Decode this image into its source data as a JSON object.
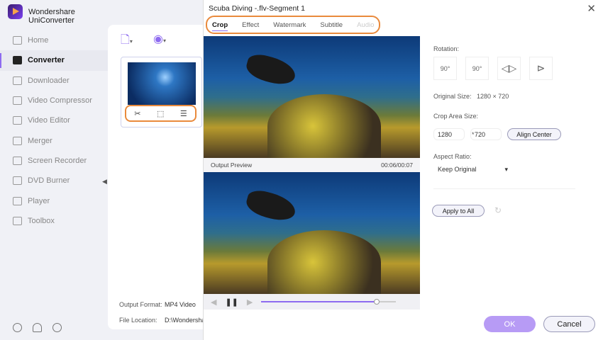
{
  "app": {
    "title": "Wondershare UniConverter"
  },
  "sidebar": {
    "items": [
      {
        "label": "Home",
        "icon": "home-icon"
      },
      {
        "label": "Converter",
        "icon": "converter-icon",
        "active": true
      },
      {
        "label": "Downloader",
        "icon": "download-icon"
      },
      {
        "label": "Video Compressor",
        "icon": "compress-icon"
      },
      {
        "label": "Video Editor",
        "icon": "scissors-icon"
      },
      {
        "label": "Merger",
        "icon": "merge-icon"
      },
      {
        "label": "Screen Recorder",
        "icon": "record-icon"
      },
      {
        "label": "DVD Burner",
        "icon": "dvd-icon"
      },
      {
        "label": "Player",
        "icon": "play-icon"
      },
      {
        "label": "Toolbox",
        "icon": "grid-icon"
      }
    ]
  },
  "main": {
    "output_format_label": "Output Format:",
    "output_format_value": "MP4 Video",
    "file_location_label": "File Location:",
    "file_location_value": "D:\\Wondersha"
  },
  "dialog": {
    "title": "Scuba Diving -.flv-Segment 1",
    "tabs": [
      {
        "label": "Crop",
        "active": true
      },
      {
        "label": "Effect"
      },
      {
        "label": "Watermark"
      },
      {
        "label": "Subtitle"
      },
      {
        "label": "Audio",
        "disabled": true
      }
    ],
    "output_preview_label": "Output Preview",
    "time": "00:06/00:07",
    "progress": 0.86,
    "rotation_label": "Rotation:",
    "rotate_cw": "90°",
    "rotate_ccw": "90°",
    "original_size_label": "Original Size:",
    "original_size_value": "1280 × 720",
    "crop_area_label": "Crop Area Size:",
    "crop_width": "1280",
    "crop_times": "*",
    "crop_height": "720",
    "align_center": "Align Center",
    "aspect_ratio_label": "Aspect Ratio:",
    "aspect_ratio_value": "Keep Original",
    "apply_all": "Apply to All",
    "ok": "OK",
    "cancel": "Cancel"
  },
  "colors": {
    "accent": "#8e6bf0",
    "highlight": "#e98a3c",
    "ok_button": "#b79bf5"
  }
}
